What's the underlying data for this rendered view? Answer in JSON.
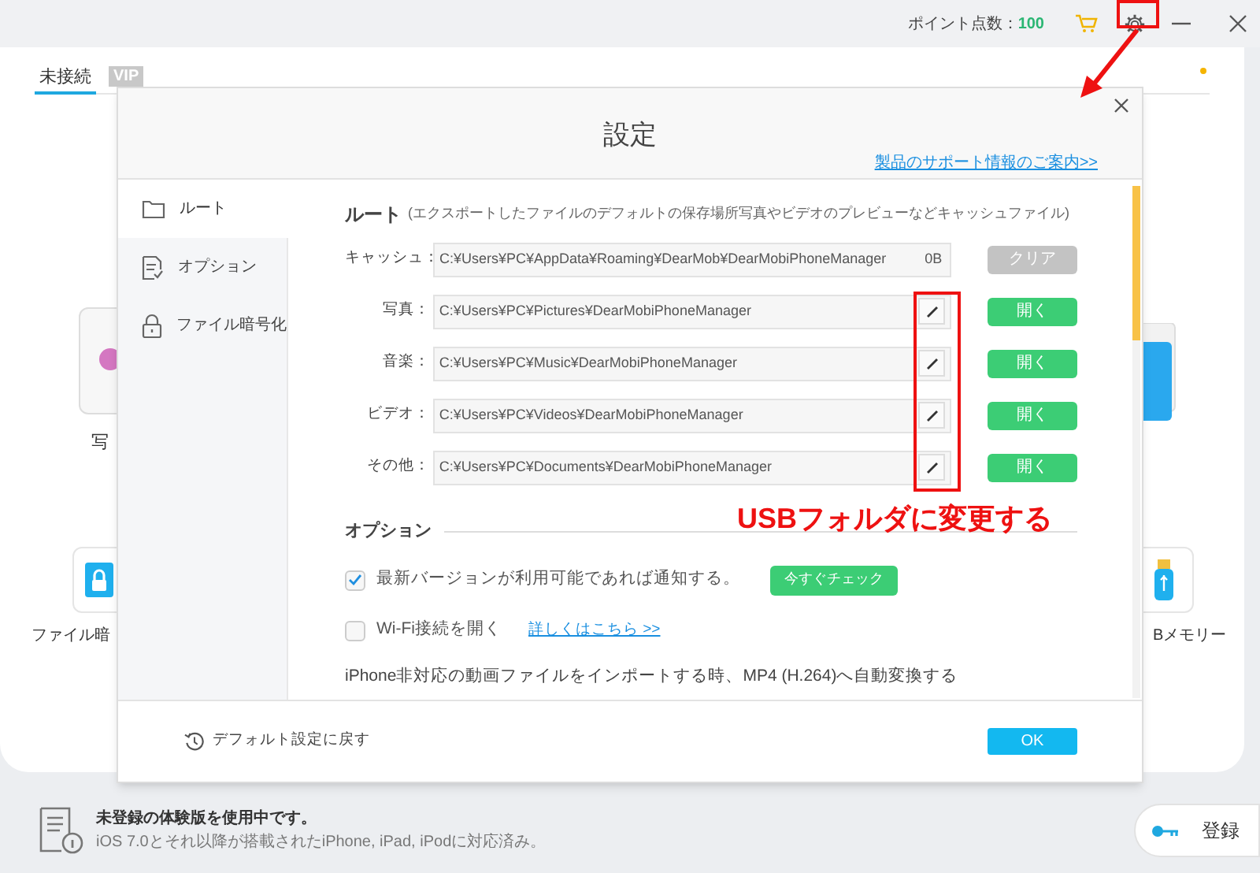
{
  "title_bar": {
    "points_label": "ポイント点数：",
    "points_value": "100"
  },
  "connection_tab": {
    "label": "未接続",
    "selected": true
  },
  "vip_badge": "VIP",
  "background_items": [
    {
      "kind": "photo",
      "label": "写"
    },
    {
      "kind": "lock",
      "label": "ファイル暗"
    },
    {
      "kind": "usb",
      "label": "Bメモリー"
    },
    {
      "kind": "folder"
    }
  ],
  "dialog": {
    "title": "設定",
    "support_link": "製品のサポート情報のご案内>>",
    "sidebar": [
      {
        "kind": "folder",
        "label": "ルート",
        "selected": true
      },
      {
        "kind": "document",
        "label": "オプション",
        "selected": false
      },
      {
        "kind": "lock",
        "label": "ファイル暗号化",
        "selected": false
      }
    ],
    "path_section": {
      "heading": "ルート",
      "note": "(エクスポートしたファイルのデフォルトの保存場所写真やビデオのプレビューなどキャッシュファイル)",
      "rows": [
        {
          "kind": "cache",
          "label": "キャッシュ：",
          "path": "C:¥Users¥PC¥AppData¥Roaming¥DearMob¥DearMobiPhoneManager",
          "size": "0B",
          "button": "クリア",
          "disabled": true
        },
        {
          "kind": "folder",
          "label": "写真：",
          "path": "C:¥Users¥PC¥Pictures¥DearMobiPhoneManager",
          "button": "開く",
          "disabled": false
        },
        {
          "kind": "folder",
          "label": "音楽：",
          "path": "C:¥Users¥PC¥Music¥DearMobiPhoneManager",
          "button": "開く",
          "disabled": false
        },
        {
          "kind": "folder",
          "label": "ビデオ：",
          "path": "C:¥Users¥PC¥Videos¥DearMobiPhoneManager",
          "button": "開く",
          "disabled": false
        },
        {
          "kind": "folder",
          "label": "その他：",
          "path": "C:¥Users¥PC¥Documents¥DearMobiPhoneManager",
          "button": "開く",
          "disabled": false
        }
      ]
    },
    "options_section": {
      "heading": "オプション",
      "items": [
        {
          "kind": "checkbox",
          "label": "最新バージョンが利用可能であれば通知する。",
          "checked": true,
          "button": "今すぐチェック"
        },
        {
          "kind": "checkbox",
          "label": "Wi-Fi接続を開く",
          "checked": false,
          "link": "詳しくはこちら >>"
        },
        {
          "kind": "text",
          "label": "iPhone非対応の動画ファイルをインポートする時、MP4 (H.264)へ自動変換する"
        }
      ]
    },
    "footer": {
      "restore": "デフォルト設定に戻す",
      "ok": "OK"
    }
  },
  "status_bar": {
    "title": "未登録の体験版を使用中です。",
    "subtitle": "iOS 7.0とそれ以降が搭載されたiPhone, iPad, iPodに対応済み。",
    "register": "登録"
  },
  "annotation": {
    "text": "USBフォルダに変更する"
  }
}
